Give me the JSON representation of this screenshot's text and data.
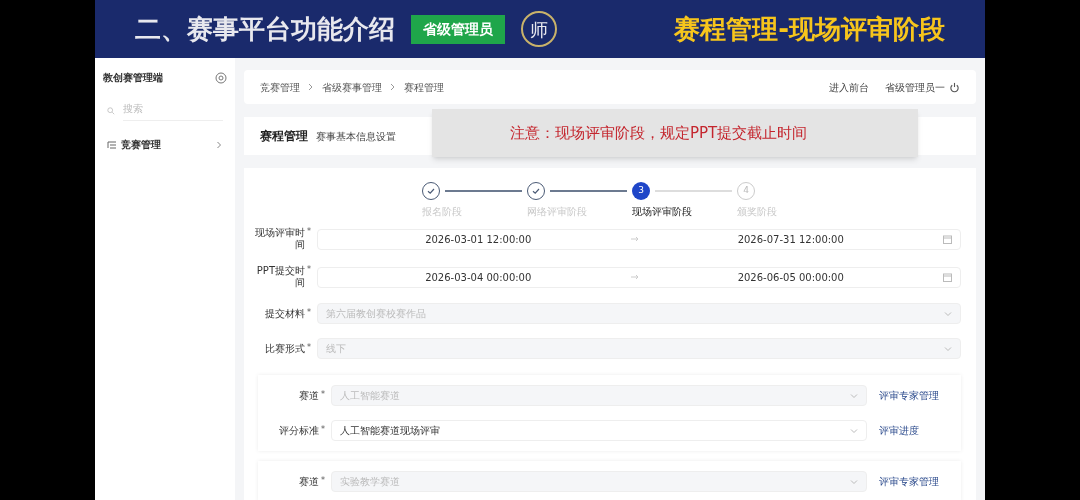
{
  "banner": {
    "title": "二、赛事平台功能介绍",
    "badge": "省级管理员",
    "logo": "师",
    "subtitle": "赛程管理-现场评审阶段"
  },
  "sidebar": {
    "title": "教创赛管理端",
    "search": {
      "placeholder": "搜索"
    },
    "items": [
      {
        "label": "竞赛管理",
        "expanded": false
      }
    ]
  },
  "breadcrumb": [
    "竞赛管理",
    "省级赛事管理",
    "赛程管理"
  ],
  "top_links": {
    "front": "进入前台",
    "user": "省级管理员一"
  },
  "page_header": {
    "title": "赛程管理",
    "subtitle": "赛事基本信息设置"
  },
  "note": {
    "text": "注意：现场评审阶段，规定PPT提交截止时间"
  },
  "steps": [
    {
      "label": "报名阶段",
      "completed": true,
      "selected": false
    },
    {
      "label": "网络评审阶段",
      "completed": true,
      "selected": false
    },
    {
      "label": "现场评审阶段",
      "completed": false,
      "selected": true,
      "number": "3"
    },
    {
      "label": "颁奖阶段",
      "completed": false,
      "selected": false,
      "number": "4"
    }
  ],
  "form": [
    {
      "kind": "daterange",
      "label": "现场评审时间",
      "required_mark": "*",
      "start": "2026-03-01 12:00:00",
      "end": "2026-07-31 12:00:00"
    },
    {
      "kind": "daterange",
      "label": "PPT提交时间",
      "required_mark": "*",
      "start": "2026-03-04 00:00:00",
      "end": "2026-06-05 00:00:00"
    },
    {
      "kind": "select",
      "label": "提交材料",
      "required_mark": "*",
      "value": "第六届教创赛校赛作品",
      "disabled": true
    },
    {
      "kind": "select",
      "label": "比赛形式",
      "required_mark": "*",
      "value": "线下",
      "disabled": true
    }
  ],
  "tracks": [
    {
      "fields": [
        {
          "label": "赛道",
          "required_mark": "*",
          "value": "人工智能赛道",
          "disabled": true,
          "link": "评审专家管理"
        },
        {
          "label": "评分标准",
          "required_mark": "*",
          "value": "人工智能赛道现场评审",
          "disabled": false,
          "link": "评审进度"
        }
      ]
    },
    {
      "fields": [
        {
          "label": "赛道",
          "required_mark": "*",
          "value": "实验教学赛道",
          "disabled": true,
          "link": "评审专家管理"
        }
      ]
    }
  ]
}
